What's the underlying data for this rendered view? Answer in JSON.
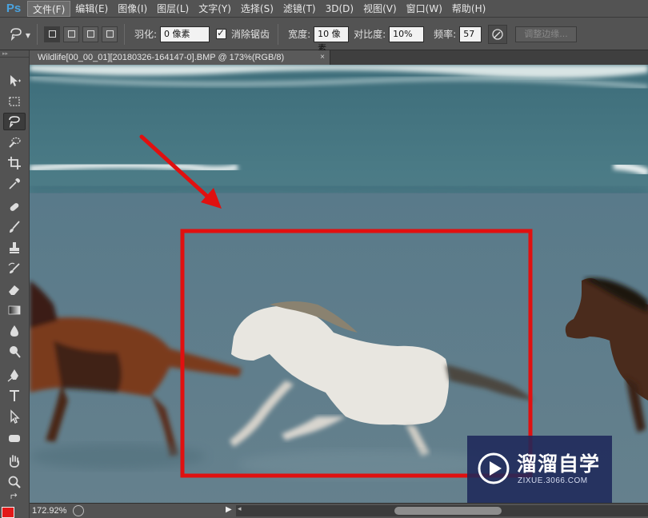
{
  "app": {
    "logo": "Ps"
  },
  "menu": [
    "文件(F)",
    "编辑(E)",
    "图像(I)",
    "图层(L)",
    "文字(Y)",
    "选择(S)",
    "滤镜(T)",
    "3D(D)",
    "视图(V)",
    "窗口(W)",
    "帮助(H)"
  ],
  "options": {
    "feather_label": "羽化:",
    "feather_value": "0 像素",
    "antialias_label": "消除锯齿",
    "width_label": "宽度:",
    "width_value": "10 像素",
    "contrast_label": "对比度:",
    "contrast_value": "10%",
    "frequency_label": "频率:",
    "frequency_value": "57",
    "refine_edge": "调整边缘..."
  },
  "document": {
    "tab_title": "Wildlife[00_00_01][20180326-164147-0].BMP @ 173%(RGB/8)",
    "close": "×"
  },
  "status": {
    "zoom": "172.92%"
  },
  "watermark": {
    "title": "溜溜自学",
    "subtitle": "ZIXUE.3066.COM"
  },
  "colors": {
    "annotation_red": "#e01010",
    "foreground_color": "#e21818",
    "ps_blue": "#4aa3df"
  },
  "tools": [
    "move-tool",
    "marquee-tool",
    "magnetic-lasso-tool",
    "quick-selection-tool",
    "crop-tool",
    "eyedropper-tool",
    "healing-brush-tool",
    "brush-tool",
    "clone-stamp-tool",
    "history-brush-tool",
    "eraser-tool",
    "gradient-tool",
    "blur-tool",
    "dodge-tool",
    "pen-tool",
    "type-tool",
    "path-selection-tool",
    "shape-tool",
    "hand-tool",
    "zoom-tool"
  ]
}
